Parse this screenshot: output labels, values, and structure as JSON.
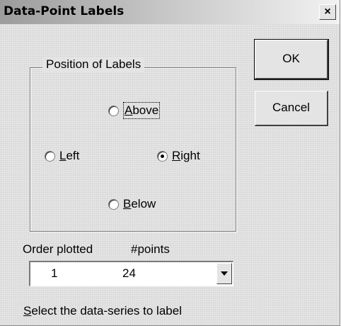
{
  "dialog": {
    "title": "Data-Point Labels",
    "close_glyph": "×",
    "close_icon": "close-icon"
  },
  "position_group": {
    "legend": "Position of Labels",
    "options": [
      {
        "key": "above",
        "mnemonic": "A",
        "rest": "bove",
        "selected": false,
        "focused": true
      },
      {
        "key": "left",
        "mnemonic": "L",
        "rest": "eft",
        "selected": false,
        "focused": false
      },
      {
        "key": "right",
        "mnemonic": "R",
        "rest": "ight",
        "selected": true,
        "focused": false
      },
      {
        "key": "below",
        "mnemonic": "B",
        "rest": "elow",
        "selected": false,
        "focused": false
      }
    ]
  },
  "buttons": {
    "ok": "OK",
    "cancel": "Cancel"
  },
  "series": {
    "col1_header": "Order plotted",
    "col2_header": "#points",
    "selected_order": "1",
    "selected_points": "24",
    "dropdown_icon": "chevron-down-icon",
    "hint_mnemonic": "S",
    "hint_rest": "elect the data-series to label"
  }
}
